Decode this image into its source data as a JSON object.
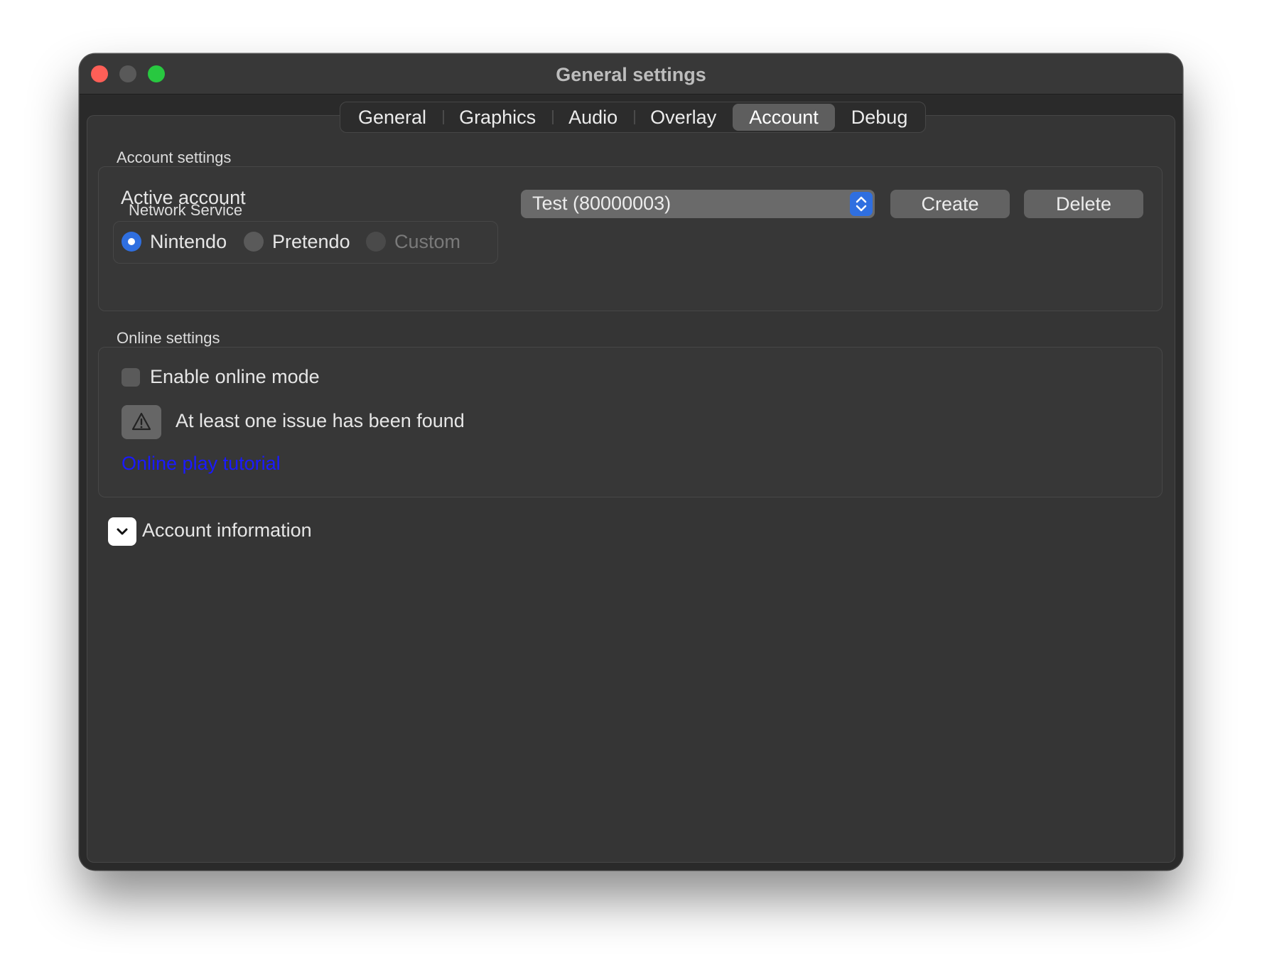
{
  "window": {
    "title": "General settings"
  },
  "tabs": [
    {
      "label": "General"
    },
    {
      "label": "Graphics"
    },
    {
      "label": "Audio"
    },
    {
      "label": "Overlay"
    },
    {
      "label": "Account",
      "active": true
    },
    {
      "label": "Debug"
    }
  ],
  "account_settings": {
    "title": "Account settings",
    "active_account_label": "Active account",
    "active_account_value": "Test (80000003)",
    "create_label": "Create",
    "delete_label": "Delete",
    "network_service": {
      "title": "Network Service",
      "options": [
        {
          "label": "Nintendo",
          "selected": true,
          "enabled": true
        },
        {
          "label": "Pretendo",
          "selected": false,
          "enabled": true
        },
        {
          "label": "Custom",
          "selected": false,
          "enabled": false
        }
      ]
    }
  },
  "online_settings": {
    "title": "Online settings",
    "enable_online_label": "Enable online mode",
    "enable_online_checked": false,
    "issue_text": "At least one issue has been found",
    "tutorial_link": "Online play tutorial"
  },
  "account_information": {
    "label": "Account information",
    "expanded": false
  },
  "colors": {
    "accent": "#2f6fe0",
    "link": "#1a1aff",
    "close": "#ff5f57",
    "maximize": "#28c840"
  }
}
